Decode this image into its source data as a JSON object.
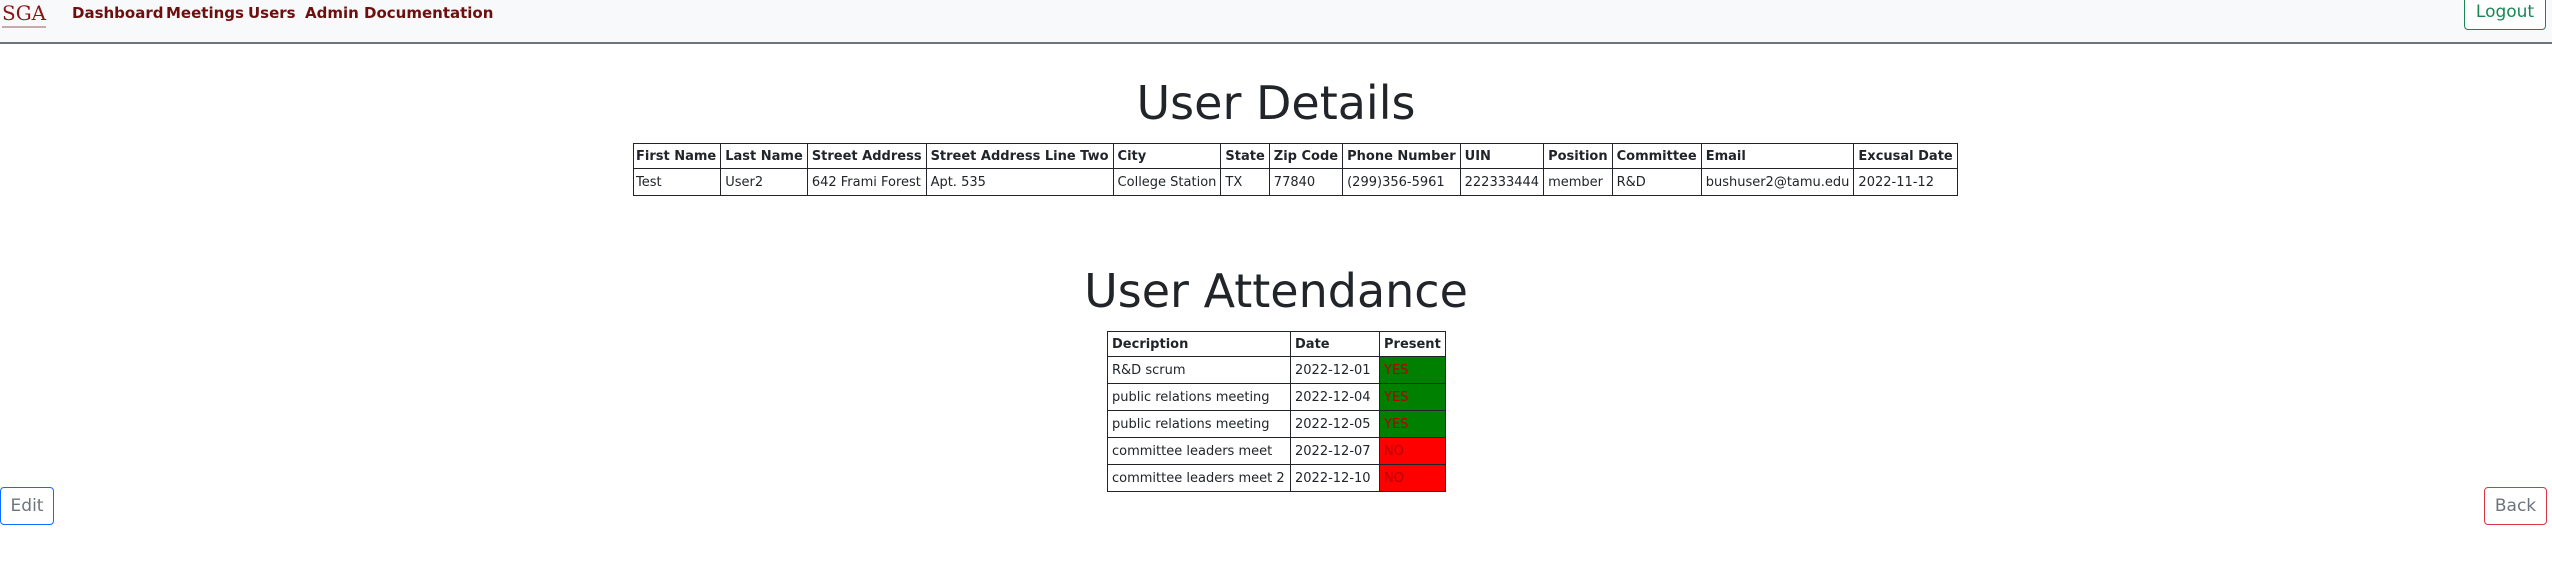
{
  "nav": {
    "brand": "SGA",
    "links": [
      "Dashboard",
      "Meetings",
      "Users",
      "Admin Documentation"
    ],
    "logout": "Logout"
  },
  "details": {
    "title": "User Details",
    "headers": [
      "First Name",
      "Last Name",
      "Street Address",
      "Street Address Line Two",
      "City",
      "State",
      "Zip Code",
      "Phone Number",
      "UIN",
      "Position",
      "Committee",
      "Email",
      "Excusal Date"
    ],
    "row": [
      "Test",
      "User2",
      "642 Frami Forest",
      "Apt. 535",
      "College Station",
      "TX",
      "77840",
      "(299)356-5961",
      "222333444",
      "member",
      "R&D",
      "bushuser2@tamu.edu",
      "2022-11-12"
    ]
  },
  "attendance": {
    "title": "User Attendance",
    "headers": [
      "Decription",
      "Date",
      "Present"
    ],
    "rows": [
      [
        "R&D scrum",
        "2022-12-01",
        "YES"
      ],
      [
        "public relations meeting",
        "2022-12-04",
        "YES"
      ],
      [
        "public relations meeting",
        "2022-12-05",
        "YES"
      ],
      [
        "committee leaders meet",
        "2022-12-07",
        "NO"
      ],
      [
        "committee leaders meet 2",
        "2022-12-10",
        "NO"
      ]
    ]
  },
  "actions": {
    "edit": "Edit",
    "back": "Back"
  },
  "colors": {
    "present_yes": "#008000",
    "present_no": "#ff0000",
    "nav_link": "#6d0f0f"
  }
}
